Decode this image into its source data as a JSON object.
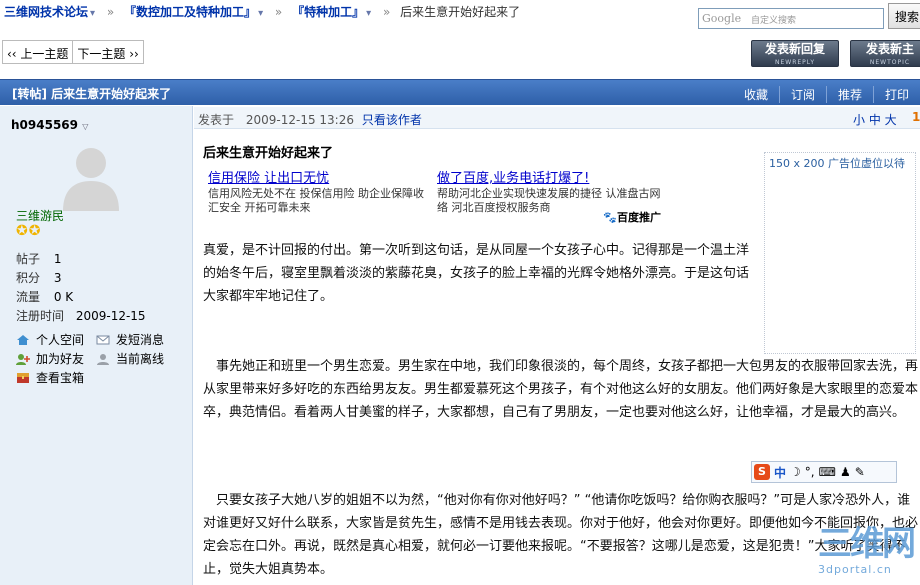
{
  "breadcrumb": {
    "forum": "三维网技术论坛",
    "board1": "『数控加工及特种加工』",
    "board2": "『特种加工』",
    "current": "后来生意开始好起来了"
  },
  "search": {
    "logo": "Google",
    "placeholder": "自定义搜索",
    "button": "搜索"
  },
  "pagenav": {
    "prev": "‹‹ 上一主题",
    "next": "下一主题 ››"
  },
  "buttons": {
    "reply": "发表新回复",
    "reply_en": "NEWREPLY",
    "newtopic": "发表新主",
    "newtopic_en": "NEWTOPIC"
  },
  "thread": {
    "tag": "[转帖]",
    "title": "后来生意开始好起来了",
    "tools": [
      "收藏",
      "订阅",
      "推荐",
      "打印"
    ]
  },
  "author": {
    "name": "h0945569",
    "group": "三维游民",
    "stars": "✪✪",
    "stats": [
      {
        "label": "帖子",
        "value": "1"
      },
      {
        "label": "积分",
        "value": "3"
      },
      {
        "label": "流量",
        "value": "0 K"
      },
      {
        "label": "注册时间",
        "value": "2009-12-15"
      }
    ],
    "actions": {
      "space": "个人空间",
      "message": "发短消息",
      "addfriend": "加为好友",
      "status": "当前离线",
      "treasure": "查看宝箱"
    }
  },
  "post": {
    "posted_prefix": "发表于",
    "posted_time": "2009-12-15 13:26",
    "view_author": "只看该作者",
    "font_sizes": "小 中 大",
    "floor": "1",
    "title": "后来生意开始好起来了",
    "paragraphs": [
      "真爱，是不计回报的付出。第一次听到这句话，是从同屋一个女孩子心中。记得那是一个温土洋的始冬午后，寝室里飘着淡淡的紫藤花臭，女孩子的脸上幸福的光辉令她格外漂亮。于是这句话大家都牢牢地记住了。",
      "　事先她正和班里一个男生恋爱。男生家在中地，我们印象很淡的，每个周终，女孩子都把一大包男友的衣服带回家去洗，再从家里带来好多好吃的东西给男友友。男生都爱慕死这个男孩子，有个对他这么好的女朋友。他们两好象是大家眼里的恋爱本卒，典范情侣。看着两人甘美蜜的样子，大家都想，自己有了男朋友，一定也要对他这么好，让他幸福，才是最大的高兴。",
      "　只要女孩子大她八岁的姐姐不以为然，“他对你有你对他好吗？” “他请你吃饭吗？给你购衣服吗？”可是人家冷恐外人，谁对谁更好又好什么联系，大家皆是贫先生，感情不是用钱去表现。你对于他好，他会对你更好。即便他如今不能回报你，也必定会忘在口外。再说，既然是真心相爱，就何必一订要他来报呢。“不要报答？这哪儿是恋爱，这是犯贵！”大家听了笑得不止，觉失大姐真势本。"
    ]
  },
  "ads": {
    "ad1_title": "信用保险 让出口无忧",
    "ad1_desc": "信用风险无处不在 投保信用险 助企业保障收汇安全 开拓可靠未来",
    "ad2_title": "做了百度,业务电话打爆了!",
    "ad2_desc": "帮助河北企业实现快速发展的捷径 认准盘古网络 河北百度授权服务商",
    "brand": "百度推广",
    "placeholder": "150 x 200 广告位虚位以待"
  },
  "ime": {
    "text": "中"
  },
  "watermark": {
    "big": "三维网",
    "small": "3dportal.cn"
  },
  "colors": {
    "header_blue": "#3a6cb8",
    "author_bg": "#e8f0f8",
    "link": "#0033aa"
  }
}
